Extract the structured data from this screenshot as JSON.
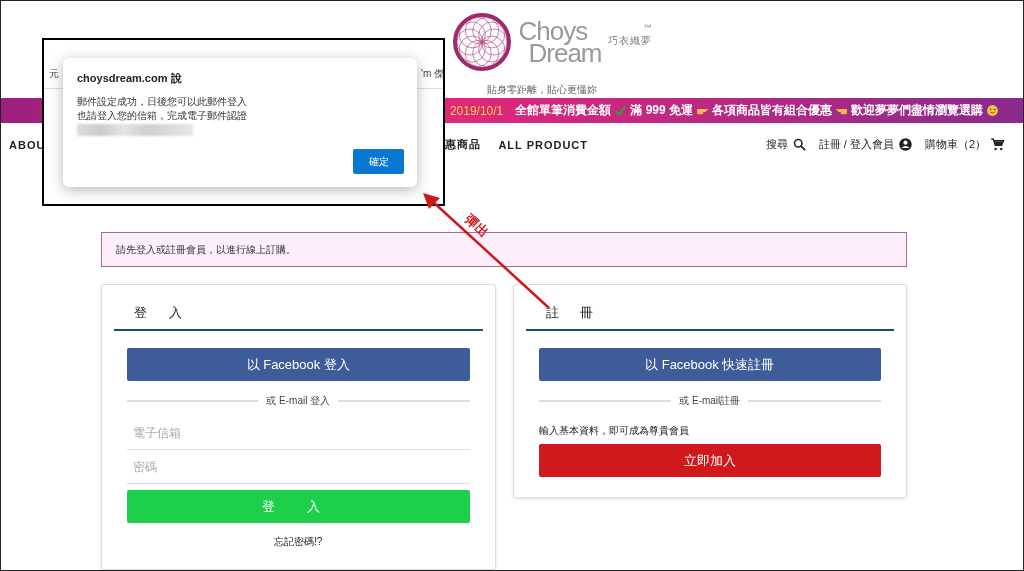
{
  "header": {
    "logo": {
      "name_top": "Choys",
      "name_bottom": "Dream",
      "chinese": "巧衣織夢",
      "tm": "™"
    },
    "tagline": "貼身零距離，貼心更懂妳"
  },
  "promo": {
    "date": "2019/10/1",
    "segments": [
      "全館單筆消費金額",
      "滿 999 免運",
      "各項商品皆有組合優惠",
      "歡迎夢夢們盡情瀏覽選購"
    ]
  },
  "nav": {
    "left": [
      "ABOU"
    ],
    "middle": [
      "惠商品",
      "ALL PRODUCT"
    ],
    "right": [
      {
        "kind": "search",
        "label": "搜尋"
      },
      {
        "kind": "account",
        "label": "註冊 / 登入會員"
      },
      {
        "kind": "cart",
        "label": "購物車（2）"
      }
    ]
  },
  "notice": "請先登入或註冊會員，以進行線上訂購。",
  "cards": [
    {
      "kind": "login",
      "title": "登 入",
      "facebook_button": "以 Facebook 登入",
      "divider": "或 E-mail 登入",
      "fields": [
        {
          "placeholder": "電子信箱"
        },
        {
          "placeholder": "密碼"
        }
      ],
      "submit_button": "登 入",
      "link": "忘記密碼!?"
    },
    {
      "kind": "register",
      "title": "註 冊",
      "facebook_button": "以 Facebook 快速註冊",
      "divider": "或 E-mail註冊",
      "note": "輸入基本資料，即可成為尊貴會員",
      "submit_button": "立即加入"
    }
  ],
  "popup_inset": {
    "background_fragments": [
      "元",
      "'m 傑"
    ],
    "dialog": {
      "title": "choysdream.com 說",
      "lines": [
        "郵件設定成功，日後您可以此郵件登入",
        "也請登入您的信箱，完成電子郵件認證"
      ],
      "button": "確定"
    }
  },
  "annotation": {
    "label": "彈出"
  }
}
